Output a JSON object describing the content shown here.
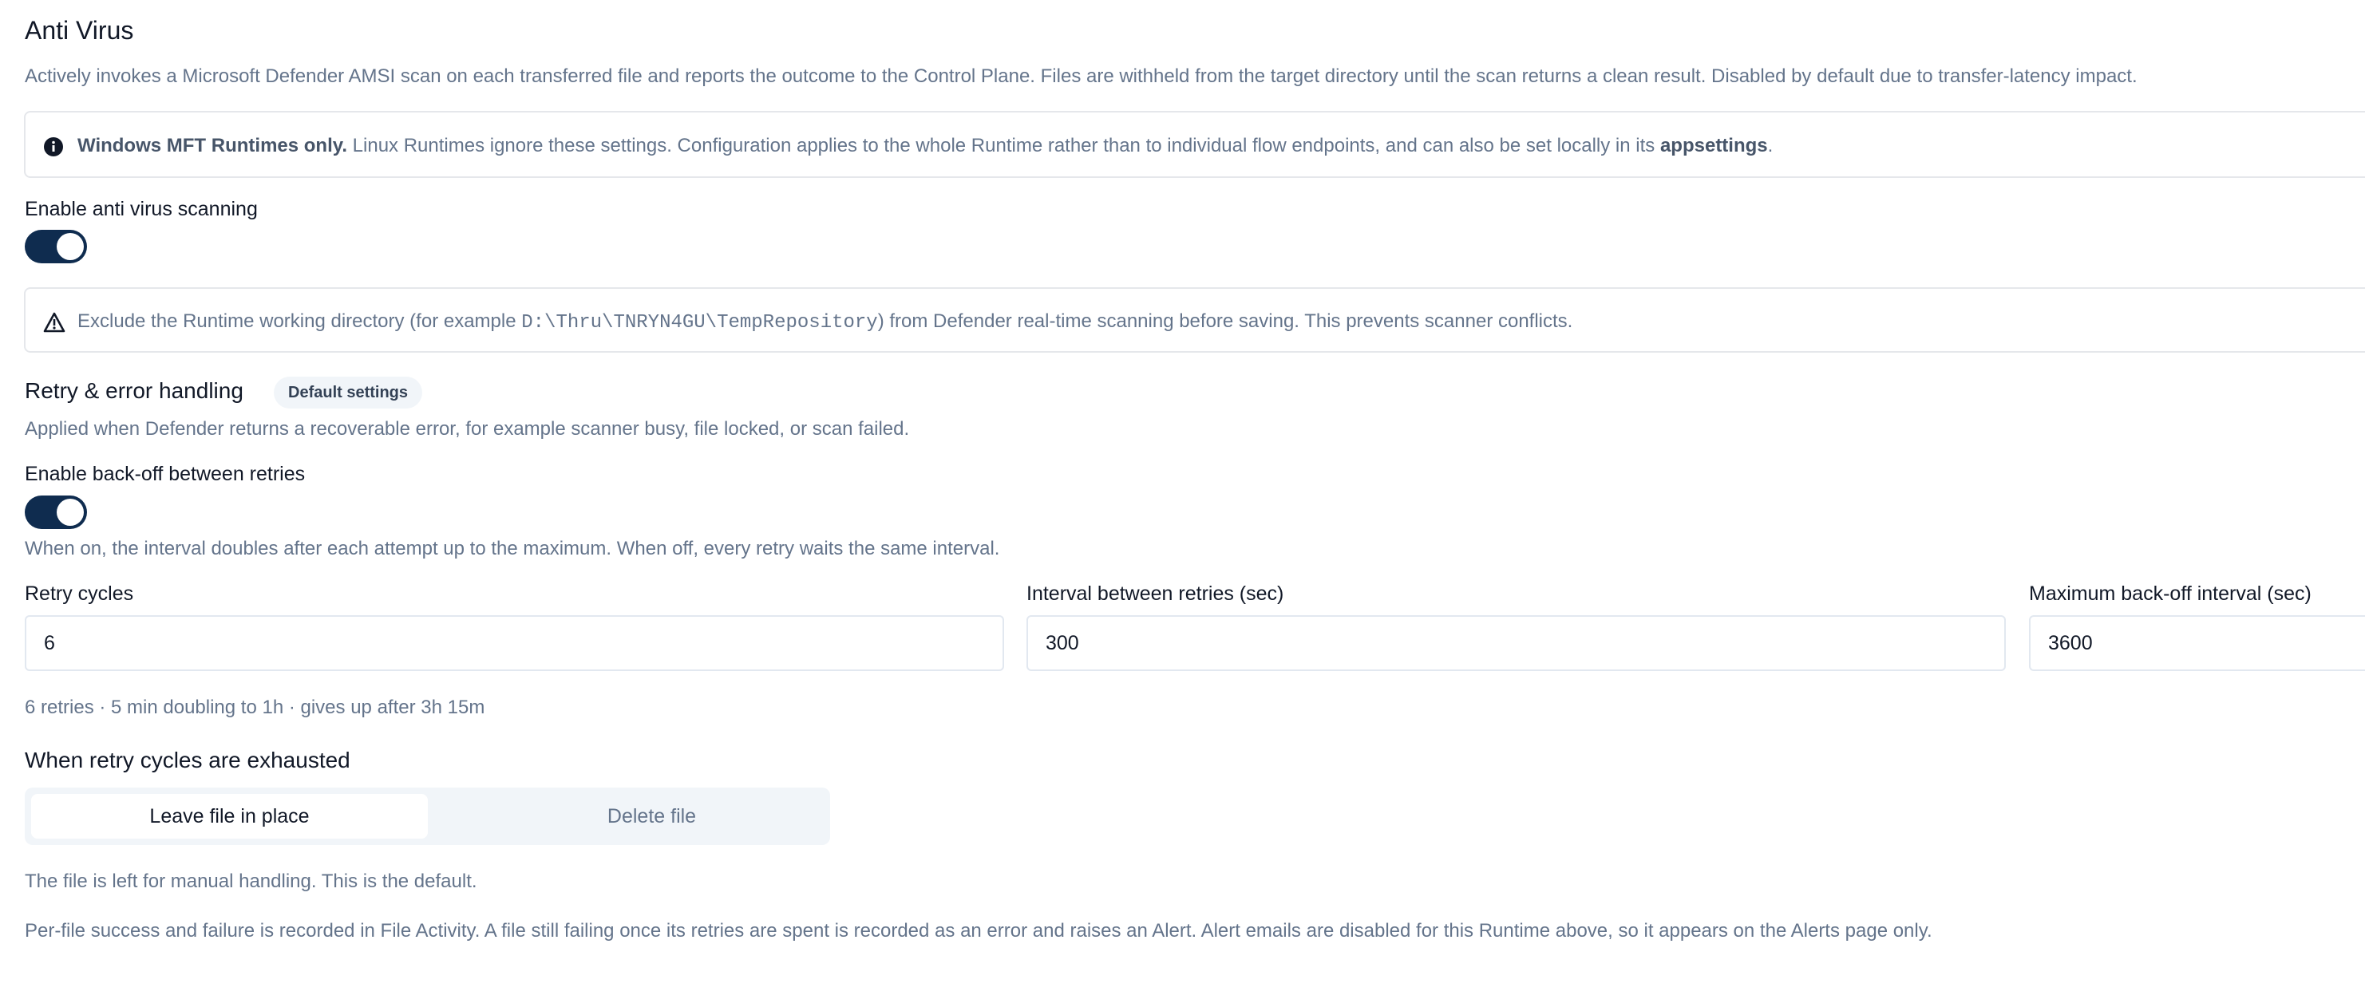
{
  "section": {
    "title": "Anti Virus",
    "description": "Actively invokes a Microsoft Defender AMSI scan on each transferred file and reports the outcome to the Control Plane. Files are withheld from the target directory until the scan returns a clean result. Disabled by default due to transfer-latency impact."
  },
  "info_callout": {
    "icon": "info-icon",
    "bold_text": "Windows MFT Runtimes only.",
    "text": " Linux Runtimes ignore these settings. Configuration applies to the whole Runtime rather than to individual flow endpoints, and can also be set locally in its ",
    "bold_end": "appsettings",
    "end": "."
  },
  "enable_scanning": {
    "label": "Enable anti virus scanning",
    "on": true
  },
  "warning_callout": {
    "icon": "warning-triangle-icon",
    "text_before": "Exclude the Runtime working directory (for example ",
    "path": "D:\\Thru\\TNRYN4GU\\TempRepository",
    "text_after": ") from Defender real-time scanning before saving. This prevents scanner conflicts."
  },
  "retry": {
    "title": "Retry & error handling",
    "badge": "Default settings",
    "description": "Applied when Defender returns a recoverable error, for example scanner busy, file locked, or scan failed.",
    "backoff_label": "Enable back-off between retries",
    "backoff_on": true,
    "backoff_help": "When on, the interval doubles after each attempt up to the maximum. When off, every retry waits the same interval.",
    "fields": {
      "cycles": {
        "label": "Retry cycles",
        "value": "6"
      },
      "interval": {
        "label": "Interval between retries (sec)",
        "value": "300"
      },
      "max_backoff": {
        "label": "Maximum back-off interval (sec)",
        "value": "3600"
      }
    },
    "summary": "6 retries · 5 min doubling to 1h · gives up after 3h 15m"
  },
  "exhausted": {
    "title": "When retry cycles are exhausted",
    "options": [
      "Leave file in place",
      "Delete file"
    ],
    "selected": "Leave file in place",
    "help": "The file is left for manual handling. This is the default.",
    "footer": "Per-file success and failure is recorded in File Activity. A file still failing once its retries are spent is recorded as an error and raises an Alert. Alert emails are disabled for this Runtime above, so it appears on the Alerts page only."
  },
  "colors": {
    "toggle_on": "#0f2c4f",
    "muted_text": "#64748b",
    "border": "#e5e7eb"
  }
}
